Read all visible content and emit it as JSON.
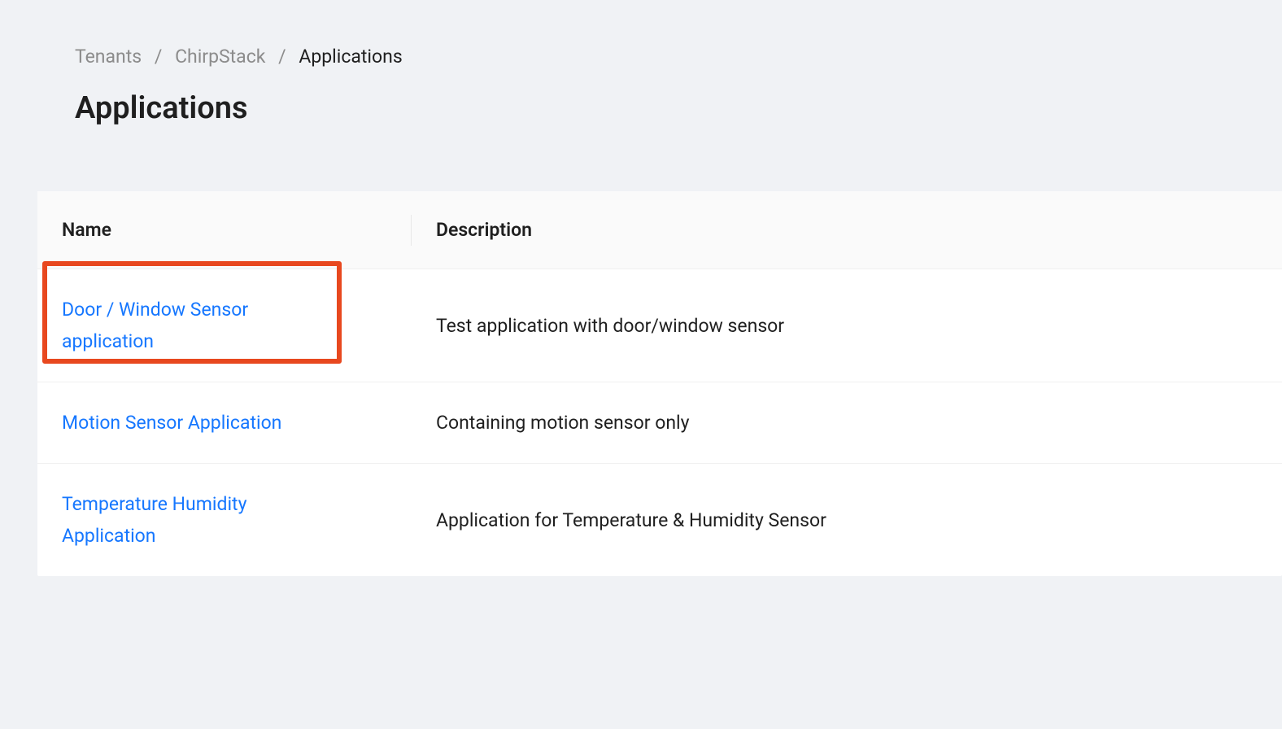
{
  "breadcrumb": {
    "items": [
      {
        "label": "Tenants",
        "current": false
      },
      {
        "label": "ChirpStack",
        "current": false
      },
      {
        "label": "Applications",
        "current": true
      }
    ],
    "separator": "/"
  },
  "page": {
    "title": "Applications"
  },
  "table": {
    "columns": [
      {
        "key": "name",
        "label": "Name"
      },
      {
        "key": "description",
        "label": "Description"
      }
    ],
    "rows": [
      {
        "name": "Door / Window Sensor application",
        "description": "Test application with door/window sensor",
        "highlighted": true
      },
      {
        "name": "Motion Sensor Application",
        "description": "Containing motion sensor only",
        "highlighted": false
      },
      {
        "name": "Temperature Humidity Application",
        "description": "Application for Temperature & Humidity Sensor",
        "highlighted": false
      }
    ]
  }
}
